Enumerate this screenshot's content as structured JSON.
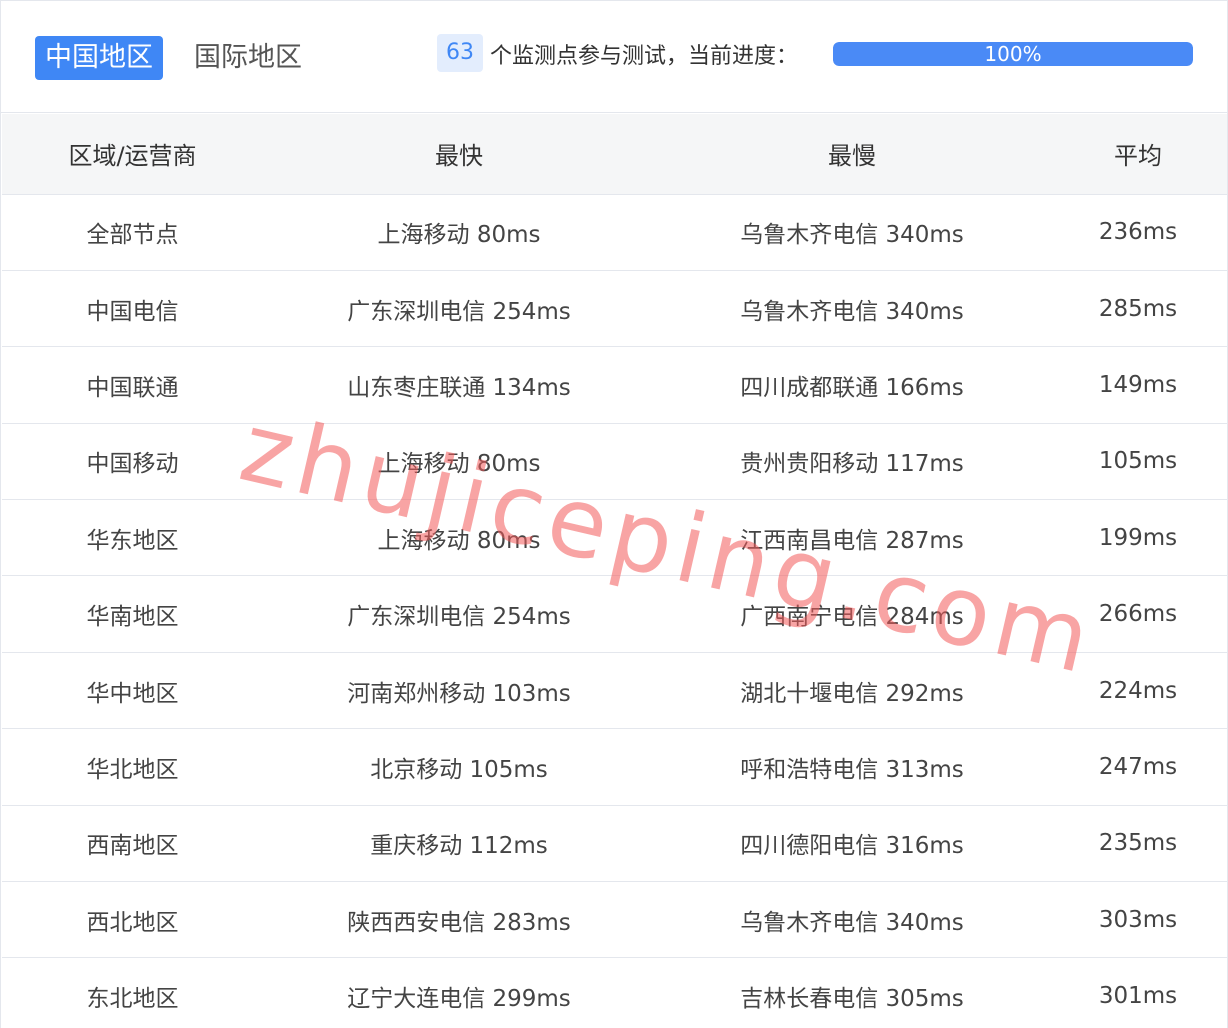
{
  "tabs": {
    "active": "中国地区",
    "inactive": "国际地区"
  },
  "status": {
    "count": "63",
    "text": "个监测点参与测试，当前进度：",
    "progress_label": "100%",
    "progress_value": 1.0,
    "progress_color": "#4a8af6"
  },
  "table": {
    "headers": [
      "区域/运营商",
      "最快",
      "最慢",
      "平均"
    ],
    "rows": [
      [
        "全部节点",
        "上海移动 80ms",
        "乌鲁木齐电信 340ms",
        "236ms"
      ],
      [
        "中国电信",
        "广东深圳电信 254ms",
        "乌鲁木齐电信 340ms",
        "285ms"
      ],
      [
        "中国联通",
        "山东枣庄联通 134ms",
        "四川成都联通 166ms",
        "149ms"
      ],
      [
        "中国移动",
        "上海移动 80ms",
        "贵州贵阳移动 117ms",
        "105ms"
      ],
      [
        "华东地区",
        "上海移动 80ms",
        "江西南昌电信 287ms",
        "199ms"
      ],
      [
        "华南地区",
        "广东深圳电信 254ms",
        "广西南宁电信 284ms",
        "266ms"
      ],
      [
        "华中地区",
        "河南郑州移动 103ms",
        "湖北十堰电信 292ms",
        "224ms"
      ],
      [
        "华北地区",
        "北京移动 105ms",
        "呼和浩特电信 313ms",
        "247ms"
      ],
      [
        "西南地区",
        "重庆移动 112ms",
        "四川德阳电信 316ms",
        "235ms"
      ],
      [
        "西北地区",
        "陕西西安电信 283ms",
        "乌鲁木齐电信 340ms",
        "303ms"
      ],
      [
        "东北地区",
        "辽宁大连电信 299ms",
        "吉林长春电信 305ms",
        "301ms"
      ]
    ]
  },
  "watermark": "zhujiceping.com",
  "colors": {
    "accent": "#3f87f5",
    "badge_bg": "#e3edfd",
    "watermark": "#f25a5a"
  }
}
